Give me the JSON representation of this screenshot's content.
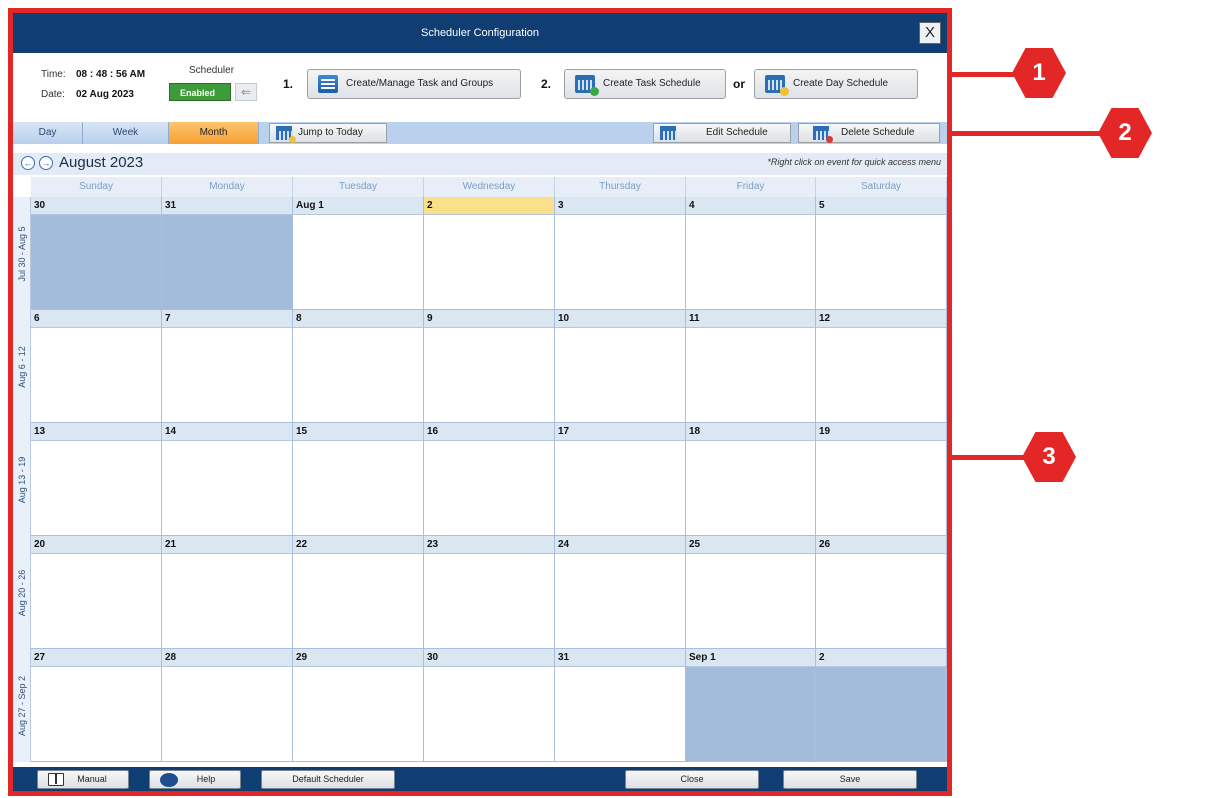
{
  "window": {
    "title": "Scheduler Configuration",
    "close_label": "X"
  },
  "header": {
    "time_label": "Time:",
    "time_value": "08 : 48 : 56 AM",
    "date_label": "Date:",
    "date_value": "02 Aug 2023",
    "scheduler_label": "Scheduler",
    "scheduler_state": "Enabled",
    "scheduler_toggle_icon": "arrow-left-icon",
    "step1": "1.",
    "step1_button": "Create/Manage Task and Groups",
    "step2": "2.",
    "step2_button": "Create Task Schedule",
    "or_label": "or",
    "step3_button": "Create Day Schedule"
  },
  "toolbar": {
    "views": [
      "Day",
      "Week",
      "Month"
    ],
    "active_view": "Month",
    "jump_today": "Jump to Today",
    "edit_schedule": "Edit Schedule",
    "delete_schedule": "Delete Schedule"
  },
  "calendar": {
    "month_title": "August 2023",
    "hint": "*Right click on event for quick access menu",
    "days_of_week": [
      "Sunday",
      "Monday",
      "Tuesday",
      "Wednesday",
      "Thursday",
      "Friday",
      "Saturday"
    ],
    "weeks": [
      {
        "label": "Jul 30 - Aug 5",
        "days": [
          "30",
          "31",
          "Aug 1",
          "2",
          "3",
          "4",
          "5"
        ],
        "outside": [
          true,
          true,
          false,
          false,
          false,
          false,
          false
        ]
      },
      {
        "label": "Aug 6 - 12",
        "days": [
          "6",
          "7",
          "8",
          "9",
          "10",
          "11",
          "12"
        ],
        "outside": [
          false,
          false,
          false,
          false,
          false,
          false,
          false
        ]
      },
      {
        "label": "Aug 13 - 19",
        "days": [
          "13",
          "14",
          "15",
          "16",
          "17",
          "18",
          "19"
        ],
        "outside": [
          false,
          false,
          false,
          false,
          false,
          false,
          false
        ]
      },
      {
        "label": "Aug 20 - 26",
        "days": [
          "20",
          "21",
          "22",
          "23",
          "24",
          "25",
          "26"
        ],
        "outside": [
          false,
          false,
          false,
          false,
          false,
          false,
          false
        ]
      },
      {
        "label": "Aug 27 - Sep 2",
        "days": [
          "27",
          "28",
          "29",
          "30",
          "31",
          "Sep 1",
          "2"
        ],
        "outside": [
          false,
          false,
          false,
          false,
          false,
          true,
          true
        ]
      }
    ],
    "today": "2"
  },
  "footer": {
    "manual": "Manual",
    "help": "Help",
    "default_scheduler": "Default Scheduler",
    "close": "Close",
    "save": "Save"
  },
  "callouts": [
    "1",
    "2",
    "3"
  ],
  "colors": {
    "titlebar": "#103e73",
    "callout": "#e32626",
    "enabled": "#3e9b3a",
    "active_tab": "#f5a033",
    "today": "#fbe08a",
    "outside_month": "#a4bcdc"
  }
}
